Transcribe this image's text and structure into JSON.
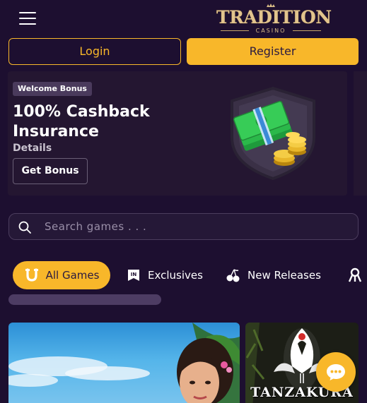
{
  "header": {
    "logo_text": "TRADITION",
    "logo_subtext": "CASINO"
  },
  "auth": {
    "login_label": "Login",
    "register_label": "Register"
  },
  "promo": {
    "badge": "Welcome Bonus",
    "title": "100% Cashback Insurance",
    "details_label": "Details",
    "cta_label": "Get Bonus"
  },
  "search": {
    "placeholder": "Search games . . ."
  },
  "tabs": [
    {
      "label": "All Games",
      "icon": "horseshoe-icon",
      "active": true
    },
    {
      "label": "Exclusives",
      "icon": "exclusive-badge-icon",
      "active": false
    },
    {
      "label": "New Releases",
      "icon": "cherries-icon",
      "active": false
    },
    {
      "label": "",
      "icon": "more-category-icon",
      "active": false
    }
  ],
  "games": [
    {
      "title": ""
    },
    {
      "title": "TANZAKURA"
    }
  ],
  "colors": {
    "background": "#1d0f30",
    "accent": "#f8b72a",
    "card": "#241631"
  }
}
